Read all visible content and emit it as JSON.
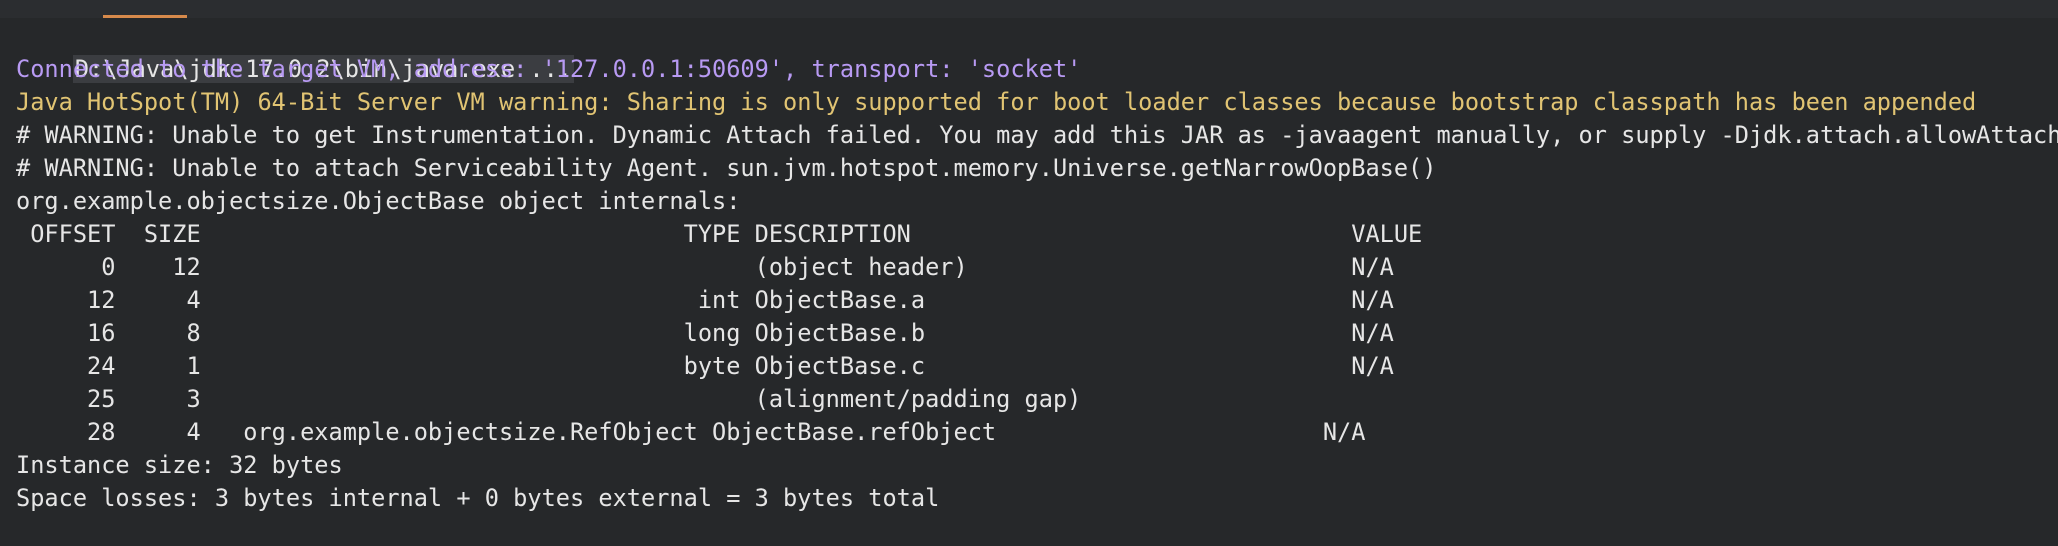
{
  "console": {
    "command_line": "D:\\Java\\jdk-17.0.2\\bin\\java.exe ...",
    "connected_line": "Connected to the target VM, address: '127.0.0.1:50609', transport: 'socket'",
    "hotspot_warning": "Java HotSpot(TM) 64-Bit Server VM warning: Sharing is only supported for boot loader classes because bootstrap classpath has been appended",
    "warning_instrumentation": "# WARNING: Unable to get Instrumentation. Dynamic Attach failed. You may add this JAR as -javaagent manually, or supply -Djdk.attach.allowAttachSe",
    "warning_serviceability": "# WARNING: Unable to attach Serviceability Agent. sun.jvm.hotspot.memory.Universe.getNarrowOopBase()",
    "internals_header": "org.example.objectsize.ObjectBase object internals:",
    "table_header": " OFFSET  SIZE                                  TYPE DESCRIPTION                               VALUE",
    "rows": [
      "      0    12                                       (object header)                           N/A",
      "     12     4                                   int ObjectBase.a                              N/A",
      "     16     8                                  long ObjectBase.b                              N/A",
      "     24     1                                  byte ObjectBase.c                              N/A",
      "     25     3                                       (alignment/padding gap)",
      "     28     4   org.example.objectsize.RefObject ObjectBase.refObject                       N/A"
    ],
    "instance_size": "Instance size: 32 bytes",
    "space_losses": "Space losses: 3 bytes internal + 0 bytes external = 3 bytes total"
  },
  "colors": {
    "background": "#26282a",
    "purple": "#b89af3",
    "yellow": "#e1c473",
    "accent_tab": "#d6894b"
  }
}
